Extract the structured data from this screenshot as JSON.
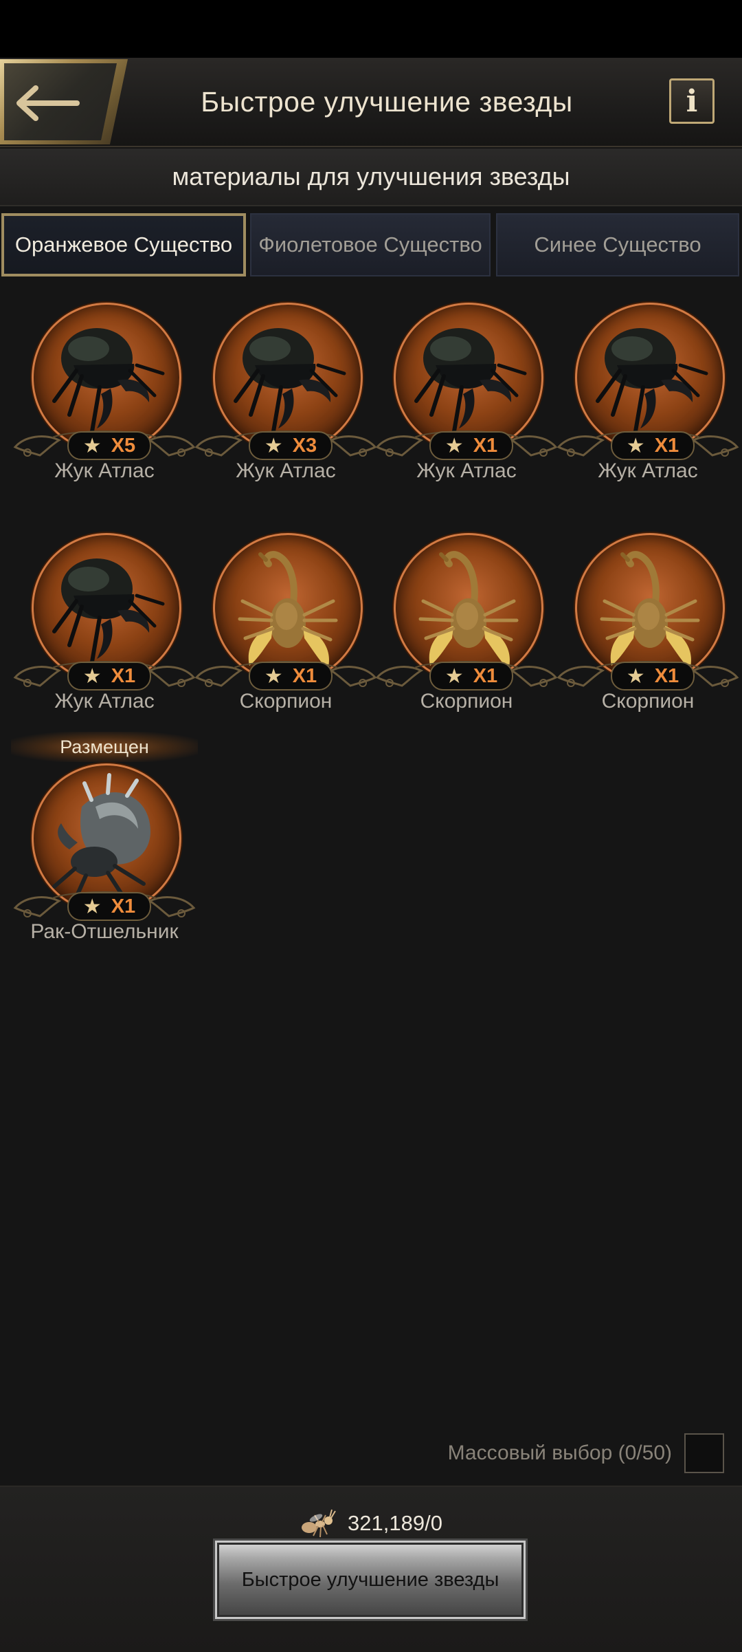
{
  "header": {
    "title": "Быстрое улучшение звезды",
    "info_label": "i"
  },
  "subtitle": "материалы для улучшения звезды",
  "tabs": [
    {
      "label": "Оранжевое Существо",
      "active": true
    },
    {
      "label": "Фиолетовое Существо",
      "active": false
    },
    {
      "label": "Синее Существо",
      "active": false
    }
  ],
  "items": [
    {
      "name": "Жук Атлас",
      "stars": "X5",
      "creature": "beetle"
    },
    {
      "name": "Жук Атлас",
      "stars": "X3",
      "creature": "beetle"
    },
    {
      "name": "Жук Атлас",
      "stars": "X1",
      "creature": "beetle"
    },
    {
      "name": "Жук Атлас",
      "stars": "X1",
      "creature": "beetle"
    },
    {
      "name": "Жук Атлас",
      "stars": "X1",
      "creature": "beetle"
    },
    {
      "name": "Скорпион",
      "stars": "X1",
      "creature": "scorpion"
    },
    {
      "name": "Скорпион",
      "stars": "X1",
      "creature": "scorpion"
    },
    {
      "name": "Скорпион",
      "stars": "X1",
      "creature": "scorpion"
    },
    {
      "name": "Рак-Отшельник",
      "stars": "X1",
      "creature": "hermit-crab",
      "tag": "Размещен"
    }
  ],
  "mass_select": {
    "label": "Массовый выбор (0/50)",
    "checked": false
  },
  "resource": {
    "value": "321,189/0",
    "icon": "ant-icon"
  },
  "action_button": {
    "label": "Быстрое улучшение звезды"
  },
  "colors": {
    "accent_gold": "#a08d60",
    "badge_count": "#ef8c3c",
    "portrait_bg": "#8c4214"
  }
}
